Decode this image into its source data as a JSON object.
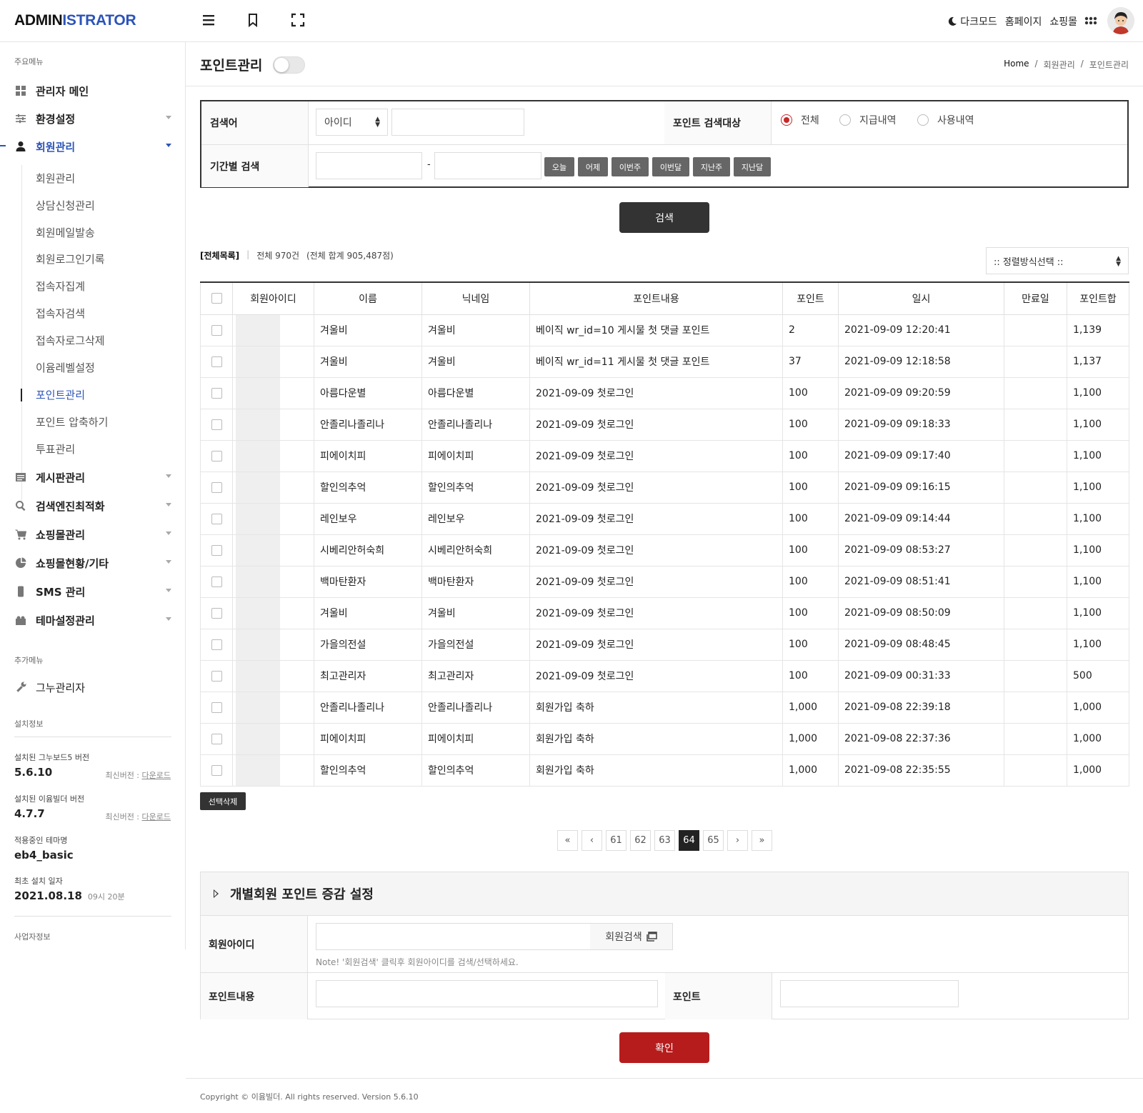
{
  "topbar": {
    "logo_a": "ADMIN",
    "logo_b": "ISTRATOR",
    "links": [
      "다크모드",
      "홈페이지",
      "쇼핑몰"
    ]
  },
  "sidebar": {
    "main_label": "주요메뉴",
    "menus": [
      {
        "label": "관리자 메인",
        "icon": "dashboard-icon"
      },
      {
        "label": "환경설정",
        "icon": "sliders-icon"
      },
      {
        "label": "회원관리",
        "icon": "user-icon"
      },
      {
        "label": "게시판관리",
        "icon": "list-icon"
      },
      {
        "label": "검색엔진최적화",
        "icon": "search-icon"
      },
      {
        "label": "쇼핑몰관리",
        "icon": "cart-icon"
      },
      {
        "label": "쇼핑몰현황/기타",
        "icon": "pie-icon"
      },
      {
        "label": "SMS 관리",
        "icon": "phone-icon"
      },
      {
        "label": "테마설정관리",
        "icon": "puzzle-icon"
      }
    ],
    "submenu": [
      "회원관리",
      "상담신청관리",
      "회원메일발송",
      "회원로그인기록",
      "접속자집계",
      "접속자검색",
      "접속자로그삭제",
      "이윰레벨설정",
      "포인트관리",
      "포인트 압축하기",
      "투표관리"
    ],
    "extra_label": "추가메뉴",
    "extra_item": "그누관리자",
    "install_label": "설치정보",
    "gnuboard_label": "설치된 그누보드5 버전",
    "gnuboard_ver": "5.6.10",
    "latest_label": "최신버전 :",
    "download": "다운로드",
    "eyoom_label": "설치된 이윰빌더 버전",
    "eyoom_ver": "4.7.7",
    "theme_label": "적용중인 테마명",
    "theme_val": "eb4_basic",
    "install_date_label": "최초 설치 일자",
    "install_date": "2021.08.18",
    "install_time": "09시 20분",
    "biz_label": "사업자정보"
  },
  "header": {
    "title": "포인트관리",
    "breadcrumb": [
      "Home",
      "/",
      "회원관리",
      "/",
      "포인트관리"
    ]
  },
  "search": {
    "keyword_label": "검색어",
    "field_select": "아이디",
    "target_label": "포인트 검색대상",
    "radios": [
      "전체",
      "지급내역",
      "사용내역"
    ],
    "period_label": "기간별 검색",
    "dash": "-",
    "date_buttons": [
      "오늘",
      "어제",
      "이번주",
      "이번달",
      "지난주",
      "지난달"
    ],
    "submit": "검색"
  },
  "list": {
    "all_label": "[전체목록]",
    "separator": "|",
    "total": "전체 970건",
    "sum": "(전체 합계 905,487점)",
    "sort_placeholder": ":: 정렬방식선택 ::",
    "columns": [
      "회원아이디",
      "이름",
      "닉네임",
      "포인트내용",
      "포인트",
      "일시",
      "만료일",
      "포인트합"
    ],
    "rows": [
      {
        "name": "겨울비",
        "nick": "겨울비",
        "content": "베이직 wr_id=10 게시물 첫 댓글 포인트",
        "point": "2",
        "date": "2021-09-09 12:20:41",
        "expire": "",
        "sum": "1,139"
      },
      {
        "name": "겨울비",
        "nick": "겨울비",
        "content": "베이직 wr_id=11 게시물 첫 댓글 포인트",
        "point": "37",
        "date": "2021-09-09 12:18:58",
        "expire": "",
        "sum": "1,137"
      },
      {
        "name": "아름다운별",
        "nick": "아름다운별",
        "content": "2021-09-09 첫로그인",
        "point": "100",
        "date": "2021-09-09 09:20:59",
        "expire": "",
        "sum": "1,100"
      },
      {
        "name": "안졸리나졸리나",
        "nick": "안졸리나졸리나",
        "content": "2021-09-09 첫로그인",
        "point": "100",
        "date": "2021-09-09 09:18:33",
        "expire": "",
        "sum": "1,100"
      },
      {
        "name": "피에이치피",
        "nick": "피에이치피",
        "content": "2021-09-09 첫로그인",
        "point": "100",
        "date": "2021-09-09 09:17:40",
        "expire": "",
        "sum": "1,100"
      },
      {
        "name": "할인의추억",
        "nick": "할인의추억",
        "content": "2021-09-09 첫로그인",
        "point": "100",
        "date": "2021-09-09 09:16:15",
        "expire": "",
        "sum": "1,100"
      },
      {
        "name": "레인보우",
        "nick": "레인보우",
        "content": "2021-09-09 첫로그인",
        "point": "100",
        "date": "2021-09-09 09:14:44",
        "expire": "",
        "sum": "1,100"
      },
      {
        "name": "시베리안허숙희",
        "nick": "시베리안허숙희",
        "content": "2021-09-09 첫로그인",
        "point": "100",
        "date": "2021-09-09 08:53:27",
        "expire": "",
        "sum": "1,100"
      },
      {
        "name": "백마탄환자",
        "nick": "백마탄환자",
        "content": "2021-09-09 첫로그인",
        "point": "100",
        "date": "2021-09-09 08:51:41",
        "expire": "",
        "sum": "1,100"
      },
      {
        "name": "겨울비",
        "nick": "겨울비",
        "content": "2021-09-09 첫로그인",
        "point": "100",
        "date": "2021-09-09 08:50:09",
        "expire": "",
        "sum": "1,100"
      },
      {
        "name": "가을의전설",
        "nick": "가을의전설",
        "content": "2021-09-09 첫로그인",
        "point": "100",
        "date": "2021-09-09 08:48:45",
        "expire": "",
        "sum": "1,100"
      },
      {
        "name": "최고관리자",
        "nick": "최고관리자",
        "content": "2021-09-09 첫로그인",
        "point": "100",
        "date": "2021-09-09 00:31:33",
        "expire": "",
        "sum": "500"
      },
      {
        "name": "안졸리나졸리나",
        "nick": "안졸리나졸리나",
        "content": "회원가입 축하",
        "point": "1,000",
        "date": "2021-09-08 22:39:18",
        "expire": "",
        "sum": "1,000"
      },
      {
        "name": "피에이치피",
        "nick": "피에이치피",
        "content": "회원가입 축하",
        "point": "1,000",
        "date": "2021-09-08 22:37:36",
        "expire": "",
        "sum": "1,000"
      },
      {
        "name": "할인의추억",
        "nick": "할인의추억",
        "content": "회원가입 축하",
        "point": "1,000",
        "date": "2021-09-08 22:35:55",
        "expire": "",
        "sum": "1,000"
      }
    ],
    "delete_button": "선택삭제"
  },
  "pager": {
    "first": "«",
    "prev": "‹",
    "pages": [
      "61",
      "62",
      "63",
      "64",
      "65"
    ],
    "current": "64",
    "next": "›",
    "last": "»"
  },
  "individual": {
    "title": "개별회원 포인트 증감 설정",
    "member_id_label": "회원아이디",
    "member_search": "회원검색",
    "note": "Note! '회원검색' 클릭후 회원아이디를 검색/선택하세요.",
    "content_label": "포인트내용",
    "point_label": "포인트",
    "submit": "확인"
  },
  "footer": {
    "copyright": "Copyright © 이윰빌더. All rights reserved. Version 5.6.10"
  },
  "colors": {
    "accent": "#2c54b8",
    "confirm": "#b71c1c",
    "dark": "#333333"
  }
}
